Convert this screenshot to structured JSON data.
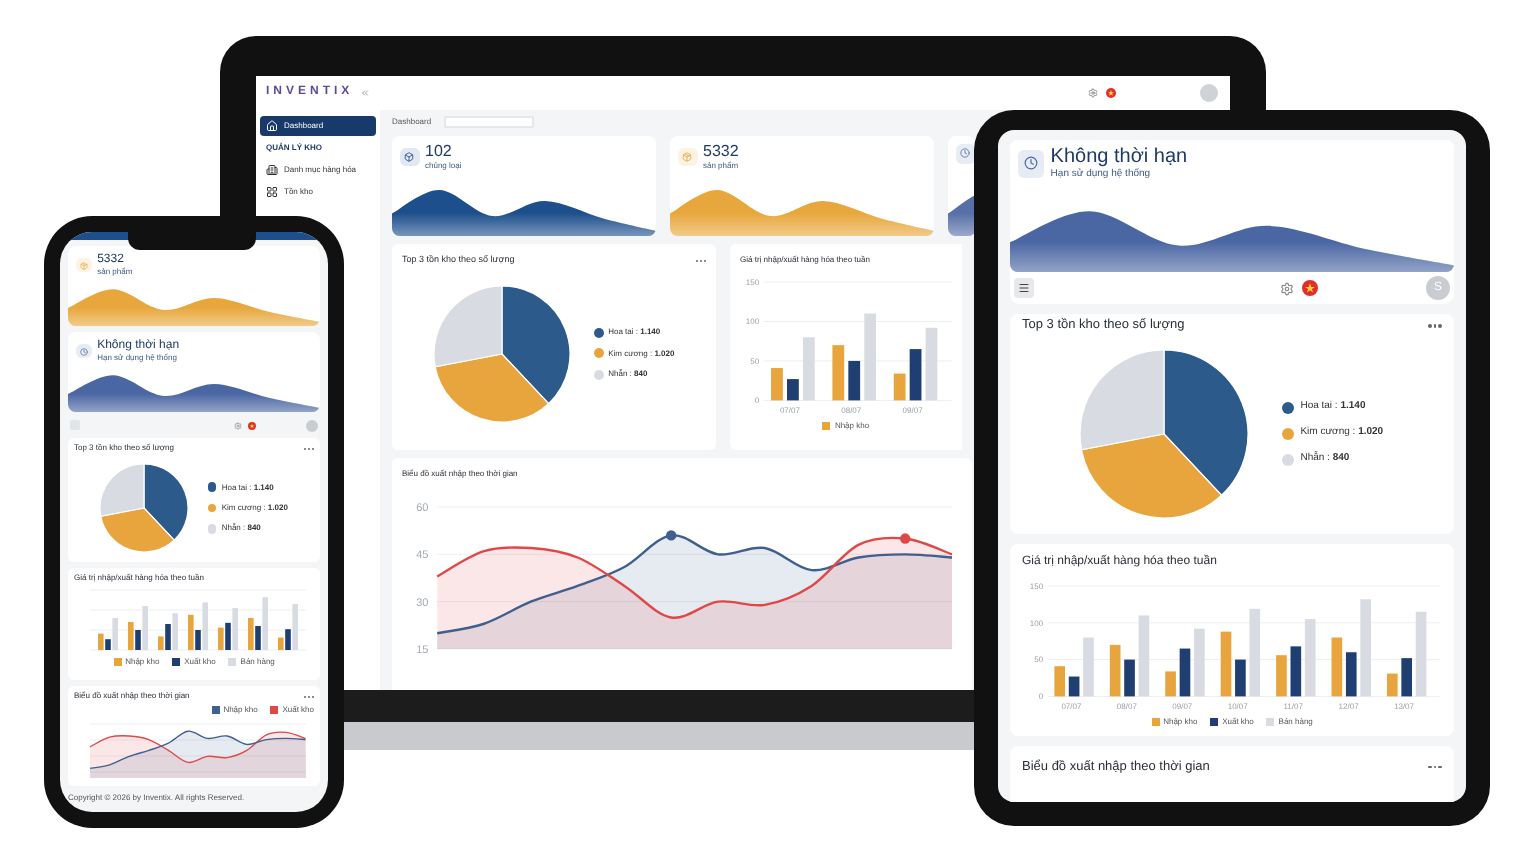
{
  "laptop": {
    "brand": "INVENTIX",
    "sidebar": [
      {
        "kind": "item",
        "label": "Dashboard",
        "selected": true
      },
      {
        "kind": "section",
        "label": "QUẢN LÝ KHO"
      },
      {
        "kind": "item",
        "label": "Danh mục hàng hóa",
        "selected": false
      },
      {
        "kind": "item",
        "label": "Tồn kho",
        "selected": false
      }
    ],
    "breadcrumb": "Dashboard",
    "stats": [
      {
        "kind": "category",
        "value": "102",
        "label": "chủng loại",
        "color": "#1d4f8c"
      },
      {
        "kind": "product",
        "value": "5332",
        "label": "sản phẩm",
        "color": "#e8a73c"
      },
      {
        "kind": "expiry",
        "color": "#5870a8"
      }
    ],
    "pie_card": {
      "title": "Top 3 tồn kho theo số lượng",
      "legend": [
        {
          "label": "Hoa tai : **1.140**",
          "color": "#2c5a8b"
        },
        {
          "label": "Kim cương : **1.020**",
          "color": "#e9a53d"
        },
        {
          "label": "Nhẫn : **840**",
          "color": "#d8dce2"
        }
      ],
      "chart_data": {
        "type": "pie",
        "values": [
          38,
          34,
          28
        ]
      }
    },
    "bar_card": {
      "title": "Giá trị nhập/xuất hàng hóa theo tuần",
      "chart_data": {
        "type": "bar",
        "grid": true,
        "categories": [
          "07/07",
          "08/07",
          "09/07"
        ],
        "ylim": [
          0,
          150
        ],
        "yticks": [
          0,
          50,
          100,
          150
        ],
        "series": [
          {
            "name": "Nhập kho",
            "color": "#e9a53d",
            "values": [
              41,
              70,
              34
            ]
          },
          {
            "color": "#1f3f73",
            "values": [
              27,
              50,
              65
            ]
          },
          {
            "color": "#d8dce2",
            "values": [
              80,
              110,
              92
            ]
          }
        ]
      }
    },
    "line_card": {
      "title": "Biểu đồ xuất nhập theo thời gian",
      "chart_data": {
        "type": "area",
        "grid": true,
        "ylim": [
          15,
          60
        ],
        "yticks": [
          15,
          30,
          45,
          60
        ],
        "series": [
          {
            "color": "#3f5f8f",
            "values": [
              20,
              23,
              30,
              35,
              41,
              51,
              45,
              47,
              40,
              44,
              45,
              44
            ]
          },
          {
            "color": "#e04848",
            "values": [
              38,
              46,
              47,
              44,
              35,
              25,
              30,
              29,
              35,
              48,
              50,
              45
            ]
          }
        ]
      }
    }
  },
  "tablet": {
    "stat": {
      "kind": "expiry",
      "value": "Không thời hạn",
      "label": "Hạn sử dụng hệ thống",
      "color": "#4a66a3"
    },
    "avatar": "S",
    "pie_card": {
      "title": "Top 3 tồn kho theo số lượng",
      "legend": [
        {
          "label": "Hoa tai : **1.140**",
          "color": "#2c5a8b"
        },
        {
          "label": "Kim cương : **1.020**",
          "color": "#e9a53d"
        },
        {
          "label": "Nhẫn : **840**",
          "color": "#d8dce2"
        }
      ],
      "chart_data": {
        "type": "pie",
        "values": [
          38,
          34,
          28
        ]
      }
    },
    "bar_card": {
      "title": "Giá trị nhập/xuất hàng hóa theo tuần",
      "chart_data": {
        "type": "bar",
        "grid": true,
        "categories": [
          "07/07",
          "08/07",
          "09/07",
          "10/07",
          "11/07",
          "12/07",
          "13/07"
        ],
        "ylim": [
          0,
          150
        ],
        "yticks": [
          0,
          50,
          100,
          150
        ],
        "series": [
          {
            "name": "Nhập kho",
            "color": "#e9a53d",
            "values": [
              41,
              70,
              34,
              88,
              56,
              80,
              31
            ]
          },
          {
            "name": "Xuất kho",
            "color": "#1f3f73",
            "values": [
              27,
              50,
              65,
              50,
              68,
              60,
              52
            ]
          },
          {
            "name": "Bán hàng",
            "color": "#d8dce2",
            "values": [
              80,
              110,
              92,
              119,
              105,
              132,
              115
            ]
          }
        ]
      }
    },
    "line_card": {
      "title": "Biểu đồ xuất nhập theo thời gian"
    }
  },
  "phone": {
    "stats": [
      {
        "kind": "product",
        "value": "5332",
        "label": "sản phẩm",
        "color": "#e8a73c"
      },
      {
        "kind": "expiry",
        "value": "Không thời hạn",
        "label": "Hạn sử dụng hệ thống",
        "color": "#4a66a3"
      }
    ],
    "pie_card": {
      "title": "Top 3 tồn kho theo số lượng",
      "legend": [
        {
          "label": "Hoa tai : **1.140**",
          "color": "#2c5a8b"
        },
        {
          "label": "Kim cương : **1.020**",
          "color": "#e9a53d"
        },
        {
          "label": "Nhẫn : **840**",
          "color": "#d8dce2"
        }
      ],
      "chart_data": {
        "type": "pie",
        "values": [
          38,
          34,
          28
        ]
      }
    },
    "bar_card": {
      "title": "Giá trị nhập/xuất hàng hóa theo tuần",
      "legend": [
        {
          "label": "Nhập kho",
          "color": "#e9a53d"
        },
        {
          "label": "Xuất kho",
          "color": "#1f3f73"
        },
        {
          "label": "Bán hàng",
          "color": "#d8dce2"
        }
      ]
    },
    "line_card": {
      "title": "Biểu đồ xuất nhập theo thời gian",
      "legend": [
        {
          "label": "Nhập kho",
          "color": "#3f5f8f"
        },
        {
          "label": "Xuất kho",
          "color": "#e04848"
        }
      ]
    },
    "footer": "Copyright © 2026 by Inventix. All rights Reserved."
  }
}
